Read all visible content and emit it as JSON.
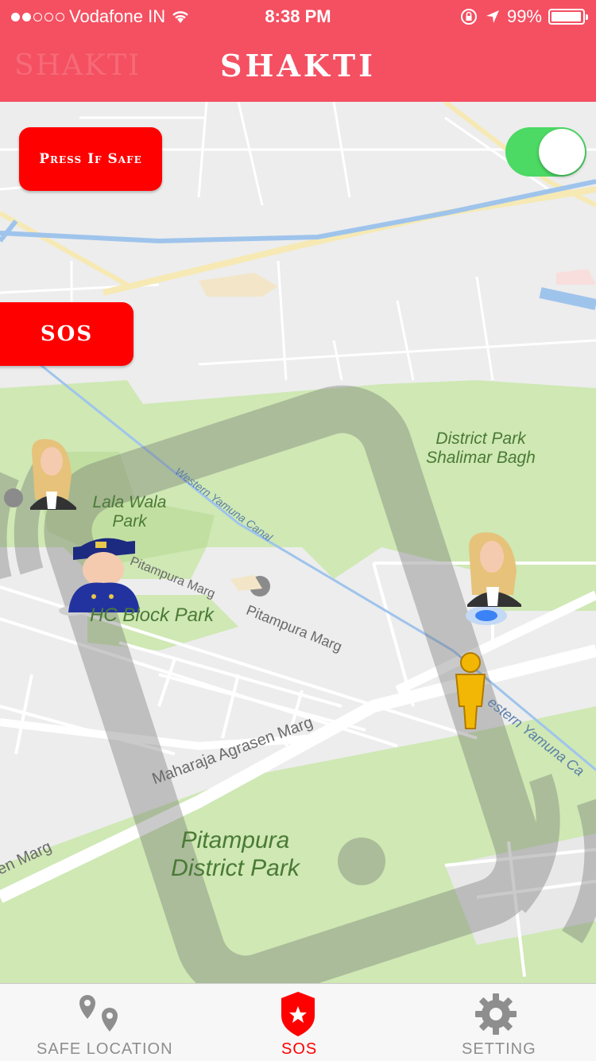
{
  "status_bar": {
    "carrier": "Vodafone IN",
    "time": "8:38 PM",
    "battery": "99%"
  },
  "nav": {
    "title": "SHAKTI",
    "back_ghost": "SHAKTI"
  },
  "controls": {
    "safe_button": "Press If Safe",
    "sos_button": "SOS",
    "toggle_on": true
  },
  "map": {
    "parks": {
      "district_park_shalimar": "District Park\nShalimar Bagh",
      "lala_wala_park": "Lala Wala\nPark",
      "block_park": "HC Block Park",
      "pitampura_district_park": "Pitampura\nDistrict Park"
    },
    "roads": {
      "pitampura_marg_1": "Pitampura Marg",
      "pitampura_marg_2": "Pitampura Marg",
      "maharaja_agrasen_marg": "Maharaja Agrasen Marg",
      "marg_left": "en Marg",
      "western_yamuna_canal_1": "Western Yamuna Canal",
      "western_yamuna_canal_2": "estern Yamuna Ca"
    }
  },
  "tabbar": {
    "tabs": [
      {
        "label": "SAFE LOCATION",
        "icon": "map-pins-icon"
      },
      {
        "label": "SOS",
        "icon": "sos-badge-icon"
      },
      {
        "label": "SETTING",
        "icon": "gear-icon"
      }
    ],
    "active_index": 1,
    "active_color": "#ff0000"
  },
  "colors": {
    "brand": "#f45062",
    "sos_red": "#ff0000",
    "toggle_green": "#4cd964",
    "park_green": "#cfe8b4"
  }
}
